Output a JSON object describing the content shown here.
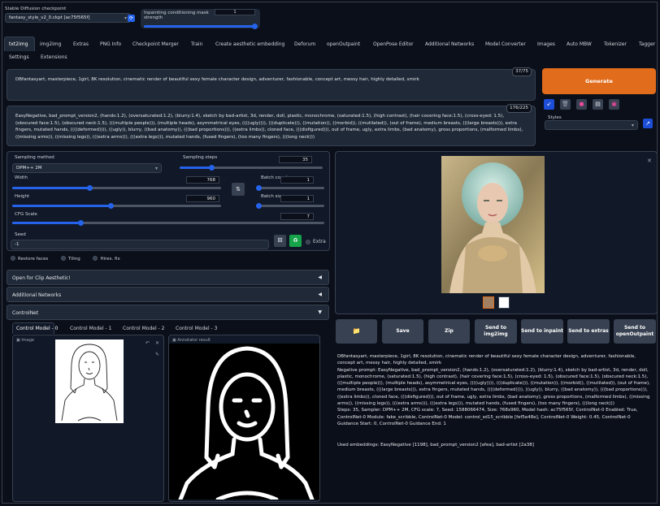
{
  "checkpoint": {
    "label": "Stable Diffusion checkpoint",
    "value": "fantasy_style_v2_0.ckpt [ac75f565f]"
  },
  "mask": {
    "label": "Inpainting conditioning mask strength",
    "value": "1"
  },
  "tabs": [
    "txt2img",
    "img2img",
    "Extras",
    "PNG Info",
    "Checkpoint Merger",
    "Train",
    "Create aesthetic embedding",
    "Deforum",
    "openOutpaint",
    "OpenPose Editor",
    "Additional Networks",
    "Model Converter",
    "Images",
    "Auto MBW",
    "Tokenizer",
    "Tagger",
    "Settings",
    "Extensions"
  ],
  "prompt": {
    "text": "DBfantasyart, masterpiece, 1girl, 8K resolution, cinematic render of beautiful sexy female character design, adventurer, fashionable, concept art, messy hair, highly detailed, smirk",
    "tokens": "37/75"
  },
  "negative": {
    "text": "EasyNegative, bad_prompt_version2, (hands:1.2), (oversaturated:1.2), (blurry:1.4), sketch by bad-artist, 3d, render, doll, plastic, monochrome, (saturated:1.5), (high contrast), (hair covering face:1.5), (cross-eyed: 1.5), (obscured face:1.5), (obscured neck:1.5), (((multiple people))), (multiple heads), asymmetrical eyes, ((((ugly)))), (((duplicate))), ((mutation)), ((morbid)), ((mutilated)), (out of frame), medium breasts, (((large breasts))), extra fingers, mutated hands, ((((deformed)))), ((ugly)), blurry, ((bad anatomy)), (((bad proportions))), ((extra limbs)), cloned face, (((disfigured))), out of frame, ugly, extra limbs, (bad anatomy), gross proportions, (malformed limbs), ((missing arms)), ((missing legs)), (((extra arms))), (((extra legs))), mutated hands, (fused fingers), (too many fingers), (((long neck)))",
    "tokens": "176/225"
  },
  "generate_label": "Generate",
  "styles_label": "Styles",
  "sampling": {
    "method_label": "Sampling method",
    "method": "DPM++ 2M",
    "steps_label": "Sampling steps",
    "steps": "35",
    "steps_frac": 0.22
  },
  "size": {
    "width_label": "Width",
    "width": "768",
    "width_frac": 0.37,
    "height_label": "Height",
    "height": "960",
    "height_frac": 0.47,
    "batch_count_label": "Batch count",
    "batch_count": "1",
    "batch_size_label": "Batch size",
    "batch_size": "1"
  },
  "cfg": {
    "label": "CFG Scale",
    "value": "7",
    "frac": 0.22
  },
  "seed": {
    "label": "Seed",
    "value": "-1",
    "extra": "Extra"
  },
  "options": [
    "Restore faces",
    "Tiling",
    "Hires. fix"
  ],
  "accordions": {
    "clip": "Open for Clip Aesthetic!",
    "networks": "Additional Networks",
    "controlnet": "ControlNet"
  },
  "controlnet_tabs": [
    "Control Model - 0",
    "Control Model - 1",
    "Control Model - 2",
    "Control Model - 3"
  ],
  "image_label": "Image",
  "annotator_label": "Annotator result",
  "actions": [
    "Save",
    "Zip",
    "Send to img2img",
    "Send to inpaint",
    "Send to extras",
    "Send to openOutpaint"
  ],
  "info": {
    "prompt": "DBfantasyart, masterpiece, 1girl, 8K resolution, cinematic render of beautiful sexy female character design, adventurer, fashionable, concept art, messy hair, highly detailed, smirk",
    "negative": "Negative prompt: EasyNegative, bad_prompt_version2, (hands:1.2), (oversaturated:1.2), (blurry:1.4), sketch by bad-artist, 3d, render, doll, plastic, monochrome, (saturated:1.5), (high contrast), (hair covering face:1.5), (cross-eyed: 1.5), (obscured face:1.5), (obscured neck:1.5), (((multiple people))), (multiple heads), asymmetrical eyes, ((((ugly)))), (((duplicate))), ((mutation)), ((morbid)), ((mutilated)), (out of frame), medium breasts, (((large breasts))), extra fingers, mutated hands, ((((deformed)))), ((ugly)), blurry, ((bad anatomy)), (((bad proportions))), ((extra limbs)), cloned face, (((disfigured))), out of frame, ugly, extra limbs, (bad anatomy), gross proportions, (malformed limbs), ((missing arms)), ((missing legs)), (((extra arms))), (((extra legs))), mutated hands, (fused fingers), (too many fingers), (((long neck)))",
    "params": "Steps: 35, Sampler: DPM++ 2M, CFG scale: 7, Seed: 1588066474, Size: 768x960, Model hash: ac75f565f, ControlNet-0 Enabled: True, ControlNet-0 Module: fake_scribble, ControlNet-0 Model: control_sd15_scribble [fef5e48e], ControlNet-0 Weight: 0.45, ControlNet-0 Guidance Start: 0, ControlNet-0 Guidance End: 1",
    "embeddings": "Used embeddings: EasyNegative [1198], bad_prompt_version2 [afea], bad-artist [2a38]"
  },
  "colors": {
    "accent": "#2563eb",
    "generate": "#e06c1c",
    "bg": "#0b0f19"
  }
}
